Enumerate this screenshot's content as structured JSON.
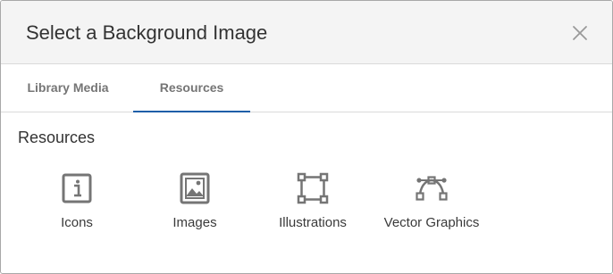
{
  "dialog": {
    "title": "Select a Background Image",
    "close_icon": "close-icon"
  },
  "tabs": [
    {
      "label": "Library Media",
      "active": false
    },
    {
      "label": "Resources",
      "active": true
    }
  ],
  "section": {
    "title": "Resources"
  },
  "resources": [
    {
      "label": "Icons",
      "icon": "info-icon"
    },
    {
      "label": "Images",
      "icon": "image-icon"
    },
    {
      "label": "Illustrations",
      "icon": "illustration-icon"
    },
    {
      "label": "Vector Graphics",
      "icon": "vector-bezier-icon"
    }
  ],
  "colors": {
    "accent": "#1f5fa8",
    "header_bg": "#f4f4f4",
    "icon": "#757575",
    "text": "#333333"
  }
}
